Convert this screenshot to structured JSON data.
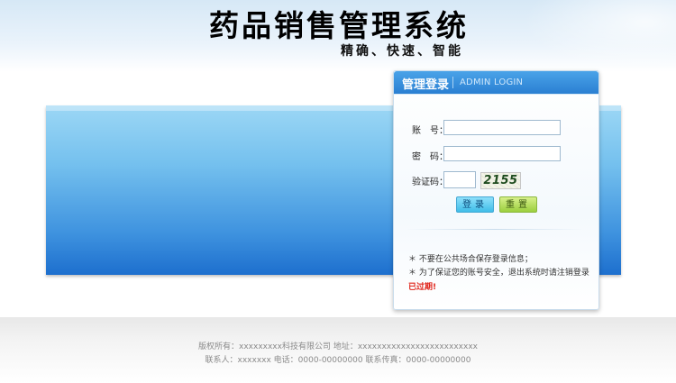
{
  "header": {
    "title": "药品销售管理系统",
    "slogan": "精确、快速、智能"
  },
  "login": {
    "title": "管理登录",
    "subtitle": "ADMIN LOGIN",
    "account_label": "账　号：",
    "account_value": "",
    "password_label": "密　码：",
    "password_value": "",
    "code_label": "验证码：",
    "code_value": "",
    "captcha_text": "2155",
    "login_button": "登录",
    "reset_button": "重置",
    "notes": [
      "＊ 不要在公共场合保存登录信息；",
      "＊ 为了保证您的账号安全，退出系统时请注销登录"
    ],
    "expired": "已过期!"
  },
  "footer": {
    "line1": "版权所有：xxxxxxxxx科技有限公司  地址：xxxxxxxxxxxxxxxxxxxxxxxxx",
    "line2": "联系人：xxxxxxx  电话：0000-00000000  联系传真：0000-00000000"
  },
  "colors": {
    "panel_header": "#2a7fd2",
    "banner_top": "#9cd7f5",
    "banner_bottom": "#1d6fce",
    "expired_text": "#e0251b"
  }
}
